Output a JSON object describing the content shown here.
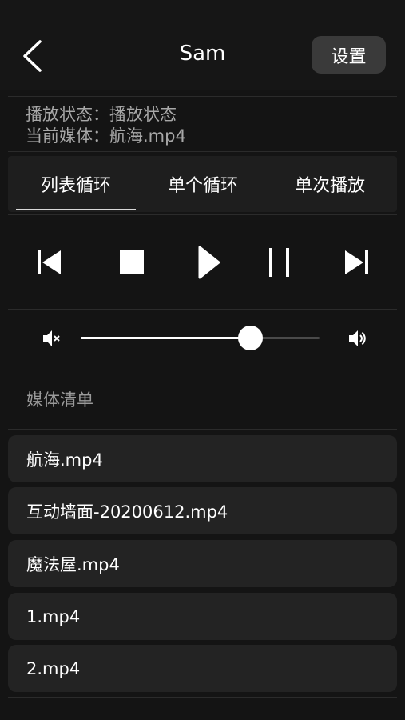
{
  "header": {
    "title": "Sam",
    "back_icon": "chevron-left-icon",
    "settings_label": "设置"
  },
  "status": {
    "play_state": "播放状态：播放状态",
    "current_media": "当前媒体：航海.mp4"
  },
  "tabs": [
    {
      "label": "列表循环",
      "active": true
    },
    {
      "label": "单个循环",
      "active": false
    },
    {
      "label": "单次播放",
      "active": false
    }
  ],
  "controls": {
    "icons": [
      "skip-previous-icon",
      "stop-icon",
      "play-icon",
      "pause-icon",
      "skip-next-icon"
    ]
  },
  "volume": {
    "level_percent": 71,
    "mute_icon": "volume-mute-icon",
    "max_icon": "volume-up-icon"
  },
  "media_section_title": "媒体清单",
  "media_list": [
    {
      "name": "航海.mp4"
    },
    {
      "name": "互动墙面-20200612.mp4"
    },
    {
      "name": "魔法屋.mp4"
    },
    {
      "name": "1.mp4"
    },
    {
      "name": "2.mp4"
    }
  ],
  "colors": {
    "background": "#141414",
    "panel": "#232323",
    "text": "#ffffff",
    "muted_text": "#a8a8a8"
  }
}
